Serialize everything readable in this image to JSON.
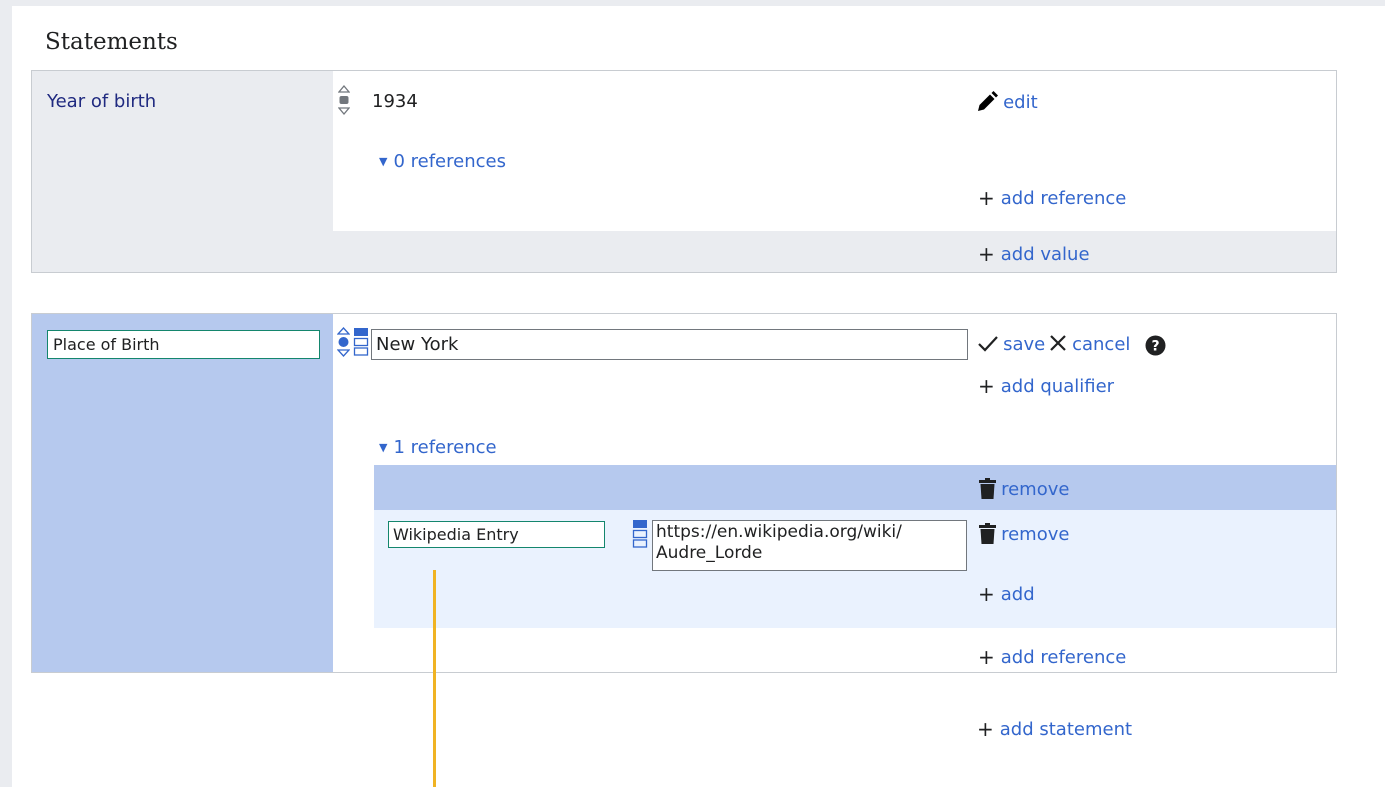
{
  "page": {
    "heading": "Statements"
  },
  "statement1": {
    "property_label": "Year of birth",
    "value": "1934",
    "edit_label": "edit",
    "references_toggle": "0 references",
    "add_reference_label": "add reference",
    "add_value_label": "add value"
  },
  "statement2": {
    "property_input_value": "Place of Birth",
    "value_input": "New York",
    "save_label": "save",
    "cancel_label": "cancel",
    "add_qualifier_label": "add qualifier",
    "references_toggle": "1 reference",
    "reference_remove_label": "remove",
    "snak_property_value": "Wikipedia Entry",
    "snak_value": "https://en.wikipedia.org/wiki/\nAudre_Lorde",
    "snak_remove_label": "remove",
    "snak_add_label": "add",
    "add_reference_label": "add reference"
  },
  "footer": {
    "add_statement_label": "add statement"
  },
  "icons": {
    "rank": "rank-selector-icon",
    "snak_type": "snak-type-selector-icon",
    "edit": "pencil-icon",
    "save": "checkmark-icon",
    "cancel": "close-icon",
    "help": "help-icon",
    "remove": "trash-icon",
    "add": "plus-icon",
    "expand": "caret-down-icon"
  },
  "colors": {
    "link": "#3366cc",
    "property_bg": "#eaecf0",
    "editing_property_bg": "#b6c9ee",
    "reference_header_bg": "#b6c9ee",
    "reference_body_bg": "#eaf2fe",
    "annotation_line": "#f0b323",
    "input_border_focus": "#14866d"
  }
}
